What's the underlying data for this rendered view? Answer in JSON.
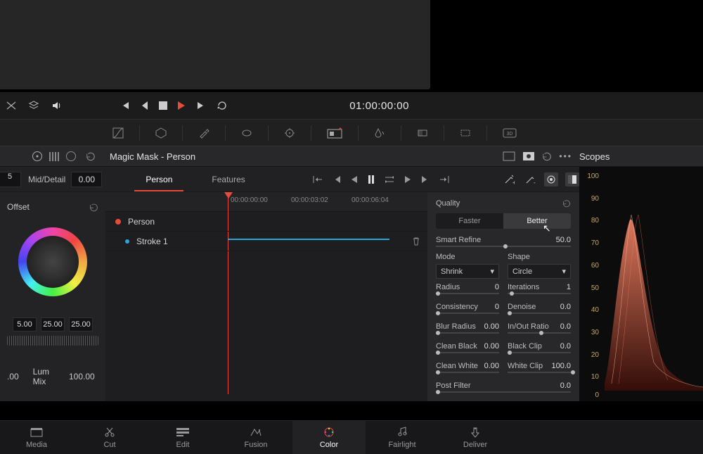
{
  "transport": {
    "timecode": "01:00:00:00"
  },
  "panel": {
    "title": "Magic Mask - Person",
    "scopes_label": "Scopes"
  },
  "mid": {
    "label": "Mid/Detail",
    "value": "0.00"
  },
  "tabs": {
    "person": "Person",
    "features": "Features"
  },
  "offset": {
    "label": "Offset"
  },
  "triple": {
    "a": "5.00",
    "b": "25.00",
    "c": "25.00"
  },
  "lum": {
    "a": ".00",
    "label": "Lum Mix",
    "value": "100.00"
  },
  "tracks": {
    "ruler_ticks": [
      "00:00:00:00",
      "00:00:03:02",
      "00:00:06:04"
    ],
    "person": "Person",
    "stroke": "Stroke 1"
  },
  "props": {
    "quality": "Quality",
    "faster": "Faster",
    "better": "Better",
    "smart_refine": "Smart Refine",
    "smart_refine_val": "50.0",
    "mode": "Mode",
    "shape": "Shape",
    "mode_val": "Shrink",
    "shape_val": "Circle",
    "radius": "Radius",
    "radius_val": "0",
    "iterations": "Iterations",
    "iterations_val": "1",
    "consistency": "Consistency",
    "consistency_val": "0",
    "denoise": "Denoise",
    "denoise_val": "0.0",
    "blur_radius": "Blur Radius",
    "blur_radius_val": "0.00",
    "inout": "In/Out Ratio",
    "inout_val": "0.0",
    "clean_black": "Clean Black",
    "clean_black_val": "0.00",
    "black_clip": "Black Clip",
    "black_clip_val": "0.0",
    "clean_white": "Clean White",
    "clean_white_val": "0.00",
    "white_clip": "White Clip",
    "white_clip_val": "100.0",
    "post_filter": "Post Filter",
    "post_filter_val": "0.0"
  },
  "scope_ticks": [
    "100",
    "90",
    "80",
    "70",
    "60",
    "50",
    "40",
    "30",
    "20",
    "10",
    "0"
  ],
  "pages": {
    "media": "Media",
    "cut": "Cut",
    "edit": "Edit",
    "fusion": "Fusion",
    "color": "Color",
    "fairlight": "Fairlight",
    "deliver": "Deliver"
  }
}
